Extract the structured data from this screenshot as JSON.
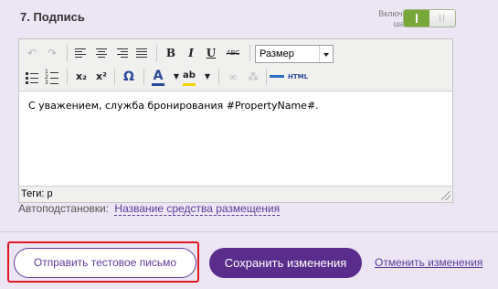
{
  "section": {
    "title": "7. Подпись",
    "toggle_label": "Включено в шаблон",
    "toggle_state": "on"
  },
  "toolbar": {
    "font_size_select": "Размер",
    "buttons_row1": [
      "undo",
      "redo",
      "align-left",
      "align-center",
      "align-right",
      "justify",
      "bold",
      "italic",
      "underline",
      "strikethrough"
    ],
    "buttons_row2": [
      "bulleted-list",
      "numbered-list",
      "subscript",
      "superscript",
      "special-character",
      "text-color",
      "highlight-color",
      "link",
      "unlink",
      "horizontal-rule",
      "html-source"
    ],
    "labels": {
      "bold": "B",
      "italic": "I",
      "underline": "U",
      "strike": "ABC",
      "subscript": "x₂",
      "superscript": "x²",
      "omega": "Ω",
      "font_color": "A",
      "highlight": "ab",
      "html": "HTML"
    }
  },
  "editor": {
    "content": "С уважением, служба бронирования #PropertyName#.",
    "status": "Теги: p"
  },
  "autosub": {
    "label": "Автоподстановки:",
    "link": "Название средства размещения"
  },
  "actions": {
    "send_test": "Отправить тестовое письмо",
    "save": "Сохранить изменения",
    "cancel": "Отменить изменения"
  },
  "colors": {
    "background": "#ece6f4",
    "primary": "#5a2d8c",
    "toggle_on": "#78a83a",
    "highlight_border": "#e21820"
  }
}
